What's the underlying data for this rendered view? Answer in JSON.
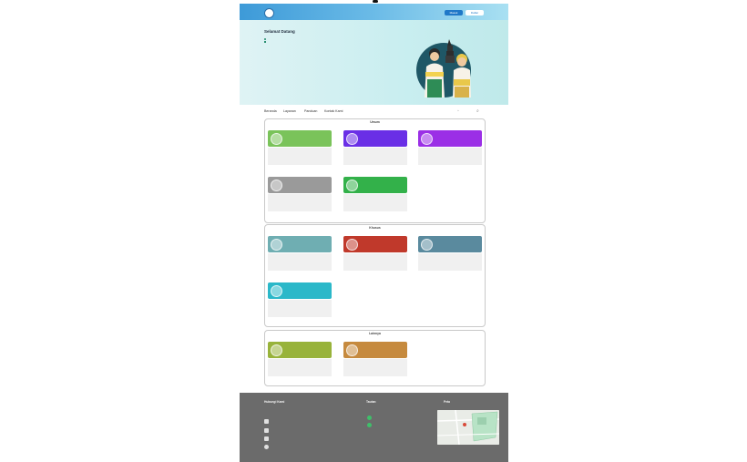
{
  "header": {
    "logo_text": "",
    "login_label": "Masuk",
    "register_label": "Daftar"
  },
  "hero": {
    "title": "Selamat Datang",
    "bullets": [
      "",
      "",
      "",
      "",
      ""
    ]
  },
  "nav": {
    "items": [
      "Beranda",
      "Layanan",
      "Panduan",
      "Kontak Kami"
    ]
  },
  "sections": [
    {
      "title": "Umum",
      "cards": [
        {
          "label": "",
          "color": "#7ac35a",
          "desc": ""
        },
        {
          "label": "",
          "color": "#6a2fe6",
          "desc": ""
        },
        {
          "label": "",
          "color": "#9b2fe6",
          "desc": ""
        },
        {
          "label": "",
          "color": "#9a9a9a",
          "desc": ""
        },
        {
          "label": "",
          "color": "#33b14a",
          "desc": ""
        }
      ]
    },
    {
      "title": "Khusus",
      "cards": [
        {
          "label": "",
          "color": "#6faeb2",
          "desc": ""
        },
        {
          "label": "",
          "color": "#c0392b",
          "desc": ""
        },
        {
          "label": "",
          "color": "#5a8a9e",
          "desc": ""
        },
        {
          "label": "",
          "color": "#2bb8c9",
          "desc": ""
        }
      ]
    },
    {
      "title": "Lainnya",
      "cards": [
        {
          "label": "",
          "color": "#98b33a",
          "desc": ""
        },
        {
          "label": "",
          "color": "#c68a3e",
          "desc": ""
        }
      ]
    }
  ],
  "footer": {
    "contact_title": "Hubungi Kami",
    "links_title": "Tautan",
    "map_title": "Peta"
  }
}
